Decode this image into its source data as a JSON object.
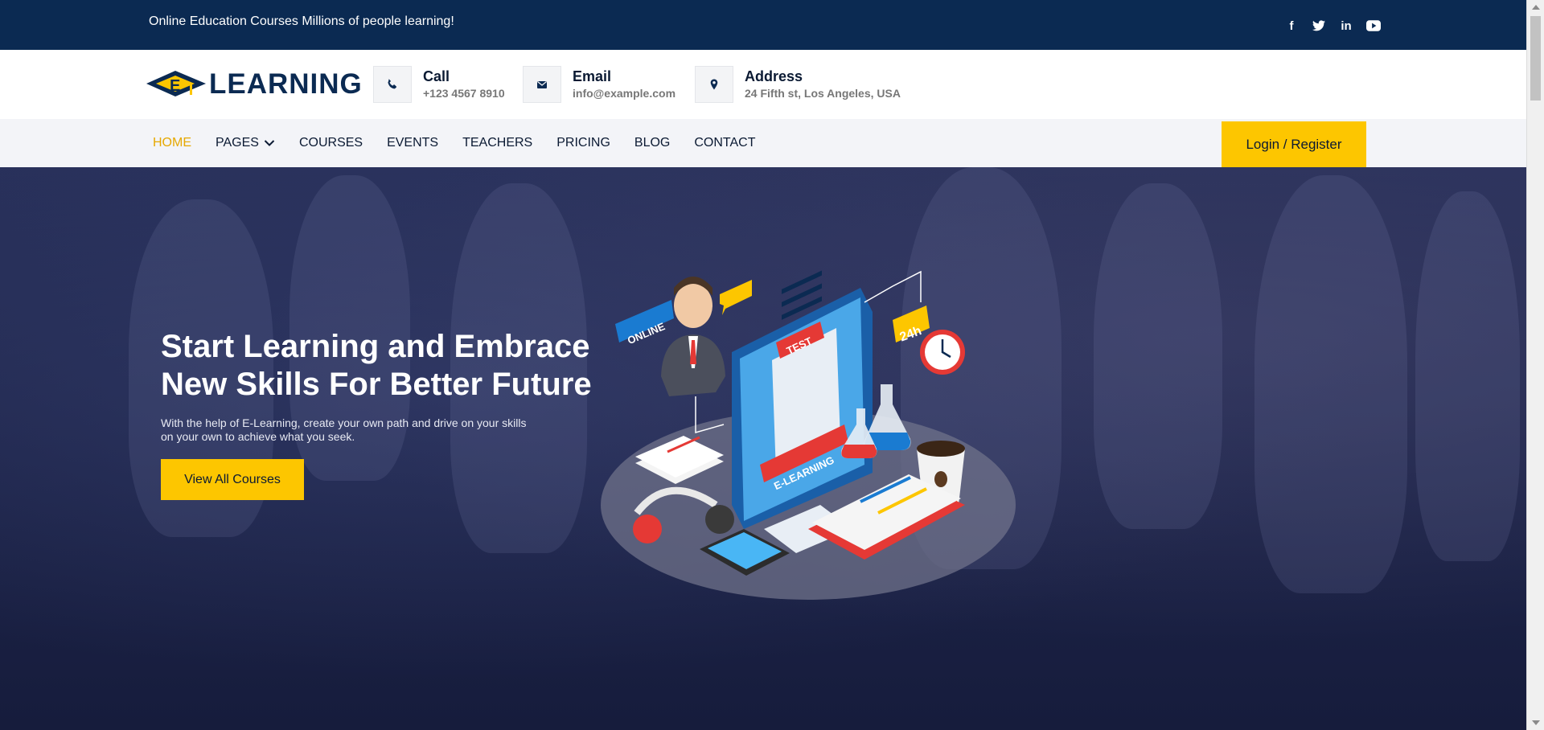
{
  "topbar": {
    "message": "Online Education Courses Millions of people learning!",
    "social": [
      {
        "icon": "facebook-icon",
        "glyph": "f"
      },
      {
        "icon": "twitter-icon",
        "glyph": "t"
      },
      {
        "icon": "linkedin-icon",
        "glyph": "in"
      },
      {
        "icon": "youtube-icon",
        "glyph": "▶"
      }
    ]
  },
  "header": {
    "logo_text": "LEARNING",
    "logo_letter": "E",
    "contacts": [
      {
        "icon": "phone-icon",
        "title": "Call",
        "value": "+123 4567 8910"
      },
      {
        "icon": "envelope-icon",
        "title": "Email",
        "value": "info@example.com"
      },
      {
        "icon": "map-pin-icon",
        "title": "Address",
        "value": "24 Fifth st, Los Angeles, USA"
      }
    ]
  },
  "nav": {
    "items": [
      "HOME",
      "PAGES",
      "COURSES",
      "EVENTS",
      "TEACHERS",
      "PRICING",
      "BLOG",
      "CONTACT"
    ],
    "active": "HOME",
    "login_label": "Login / Register"
  },
  "hero": {
    "title_line1": "Start Learning and Embrace",
    "title_line2": "New Skills For Better Future",
    "subtitle": "With the help of E-Learning, create your own path and drive on your skills on your own to achieve what you seek.",
    "button_label": "View All Courses",
    "illustration_labels": {
      "online": "ONLINE",
      "test": "TEST",
      "elearning": "E-LEARNING",
      "hours": "24h"
    }
  },
  "colors": {
    "navy": "#0b2a52",
    "accent_yellow": "#fdc600",
    "active_nav": "#e6a800"
  }
}
